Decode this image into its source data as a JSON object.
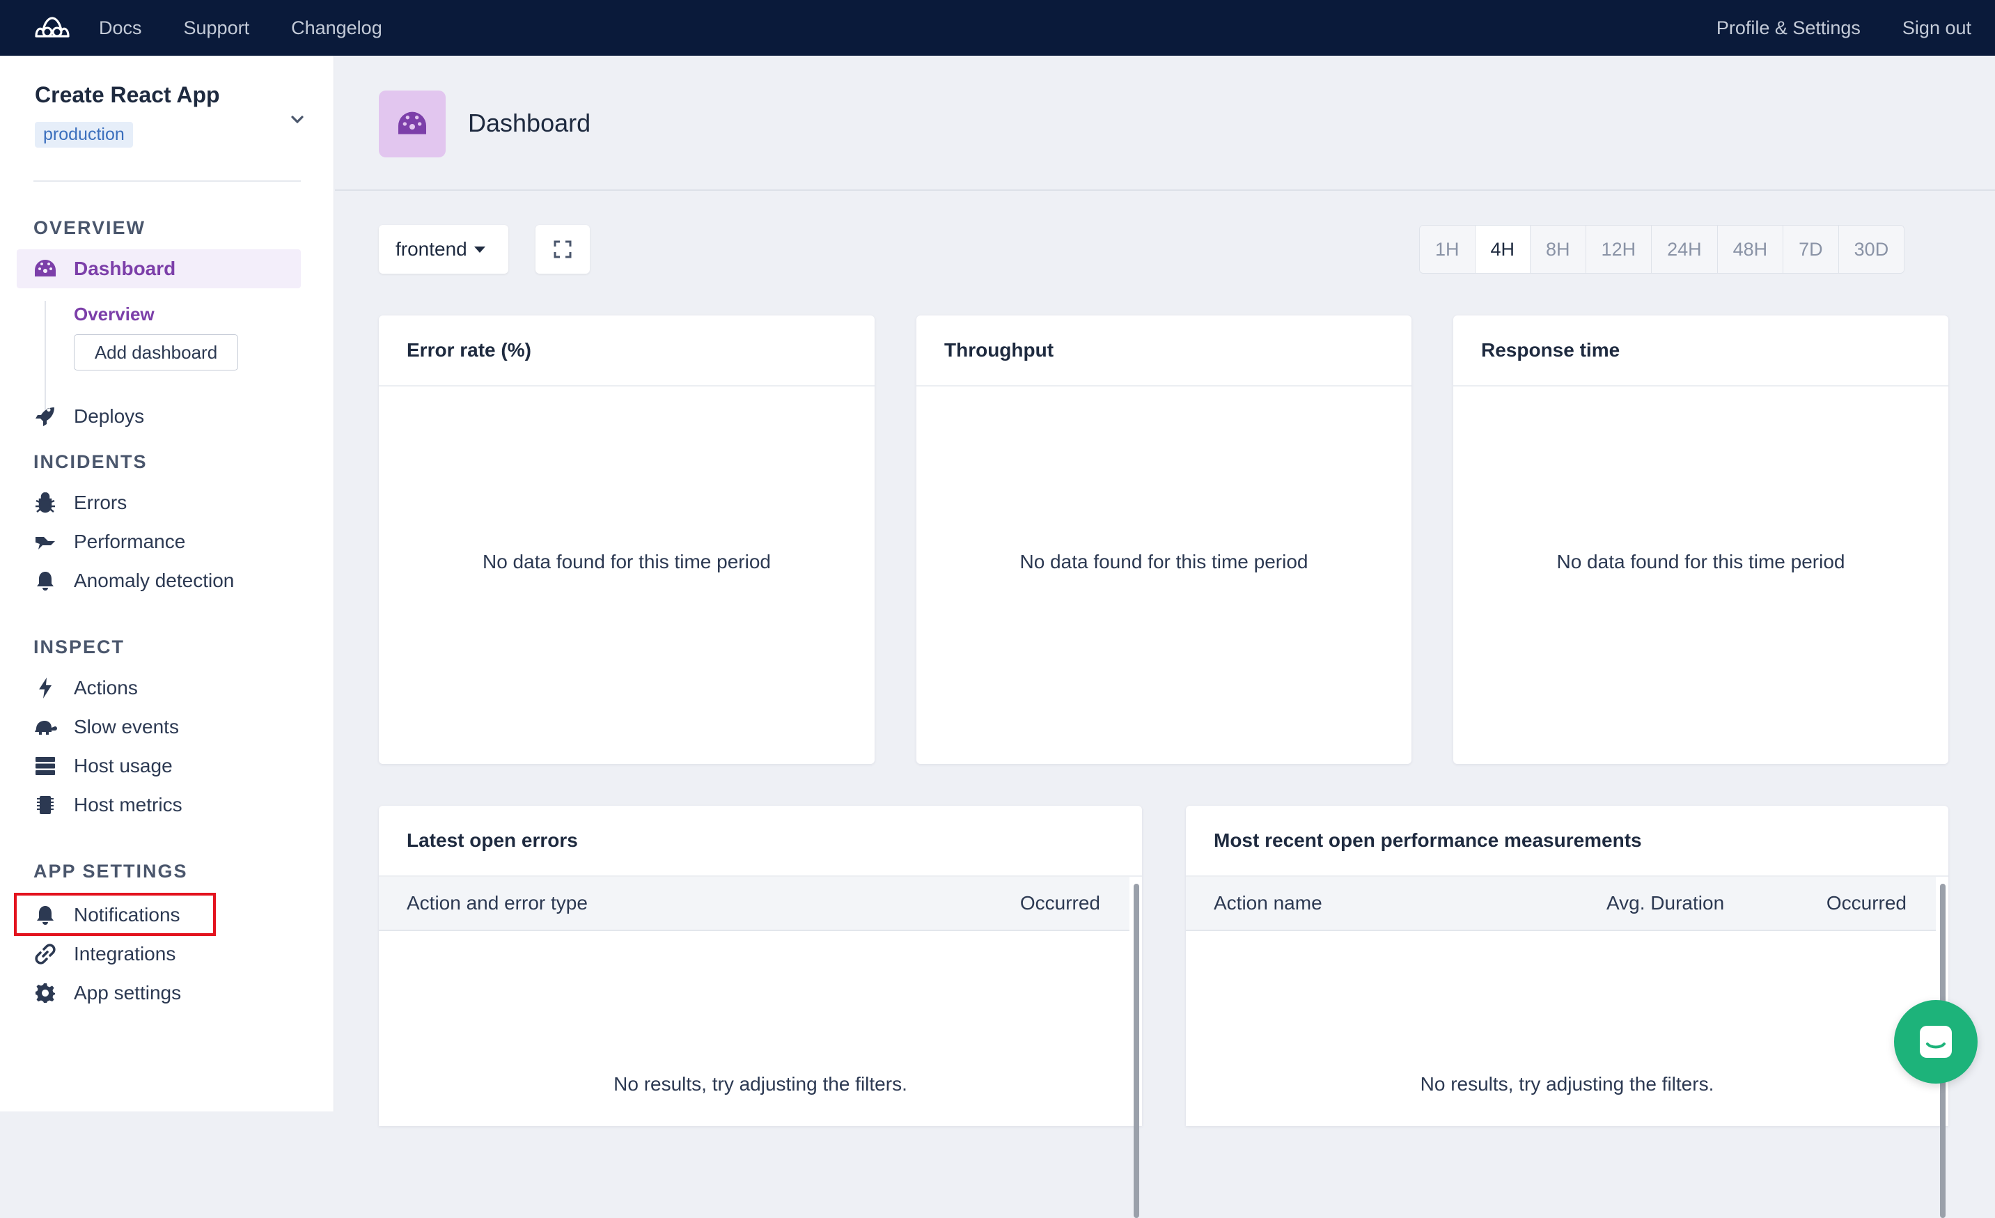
{
  "topbar": {
    "nav": [
      "Docs",
      "Support",
      "Changelog"
    ],
    "profile_label": "Profile & Settings",
    "signout_label": "Sign out"
  },
  "sidebar": {
    "app_name": "Create React App",
    "environment": "production",
    "overview": {
      "title": "OVERVIEW",
      "dashboard_label": "Dashboard",
      "sub_overview": "Overview",
      "add_dashboard": "Add dashboard",
      "deploys_label": "Deploys"
    },
    "incidents": {
      "title": "INCIDENTS",
      "items": [
        "Errors",
        "Performance",
        "Anomaly detection"
      ]
    },
    "inspect": {
      "title": "INSPECT",
      "items": [
        "Actions",
        "Slow events",
        "Host usage",
        "Host metrics"
      ]
    },
    "app_settings": {
      "title": "APP SETTINGS",
      "items": [
        "Notifications",
        "Integrations",
        "App settings"
      ]
    }
  },
  "main": {
    "title": "Dashboard",
    "namespace": "frontend",
    "ranges": [
      "1H",
      "4H",
      "8H",
      "12H",
      "24H",
      "48H",
      "7D",
      "30D"
    ],
    "active_range": "4H",
    "cards": [
      {
        "title": "Error rate (%)",
        "empty": "No data found for this time period"
      },
      {
        "title": "Throughput",
        "empty": "No data found for this time period"
      },
      {
        "title": "Response time",
        "empty": "No data found for this time period"
      }
    ],
    "errors_table": {
      "title": "Latest open errors",
      "columns": [
        "Action and error type",
        "Occurred"
      ],
      "empty": "No results, try adjusting the filters."
    },
    "perf_table": {
      "title": "Most recent open performance measurements",
      "columns": [
        "Action name",
        "Avg. Duration",
        "Occurred"
      ],
      "empty": "No results, try adjusting the filters."
    }
  },
  "colors": {
    "topbar": "#0a1a3a",
    "accent": "#7c3fa9",
    "highlight": "#e3131e",
    "chat": "#1db37a"
  }
}
